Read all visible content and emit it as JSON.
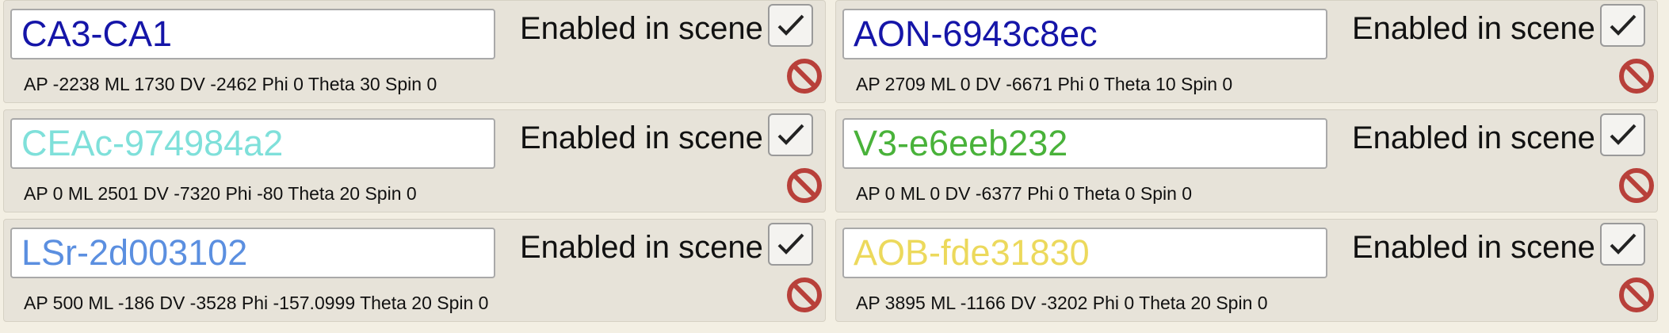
{
  "enabled_label": "Enabled in scene",
  "icons": {
    "check": "checkmark-icon",
    "delete": "no-entry-icon"
  },
  "colors": {
    "delete_red": "#b8403a"
  },
  "cards": [
    {
      "name": "CA3-CA1",
      "name_color": "#1515a8",
      "coords": "AP -2238 ML 1730 DV -2462 Phi 0 Theta 30 Spin 0"
    },
    {
      "name": "AON-6943c8ec",
      "name_color": "#1515a8",
      "coords": "AP 2709 ML 0 DV -6671 Phi 0 Theta 10 Spin 0"
    },
    {
      "name": "CEAc-974984a2",
      "name_color": "#7fe0da",
      "coords": "AP 0 ML 2501 DV -7320 Phi -80 Theta 20 Spin 0"
    },
    {
      "name": "V3-e6eeb232",
      "name_color": "#49b23a",
      "coords": "AP 0 ML 0 DV -6377 Phi 0 Theta 0 Spin 0"
    },
    {
      "name": "LSr-2d003102",
      "name_color": "#5b8fe0",
      "coords": "AP 500 ML -186 DV -3528 Phi -157.0999 Theta 20 Spin 0"
    },
    {
      "name": "AOB-fde31830",
      "name_color": "#ecd95c",
      "coords": "AP 3895 ML -1166 DV -3202 Phi 0 Theta 20 Spin 0"
    }
  ]
}
